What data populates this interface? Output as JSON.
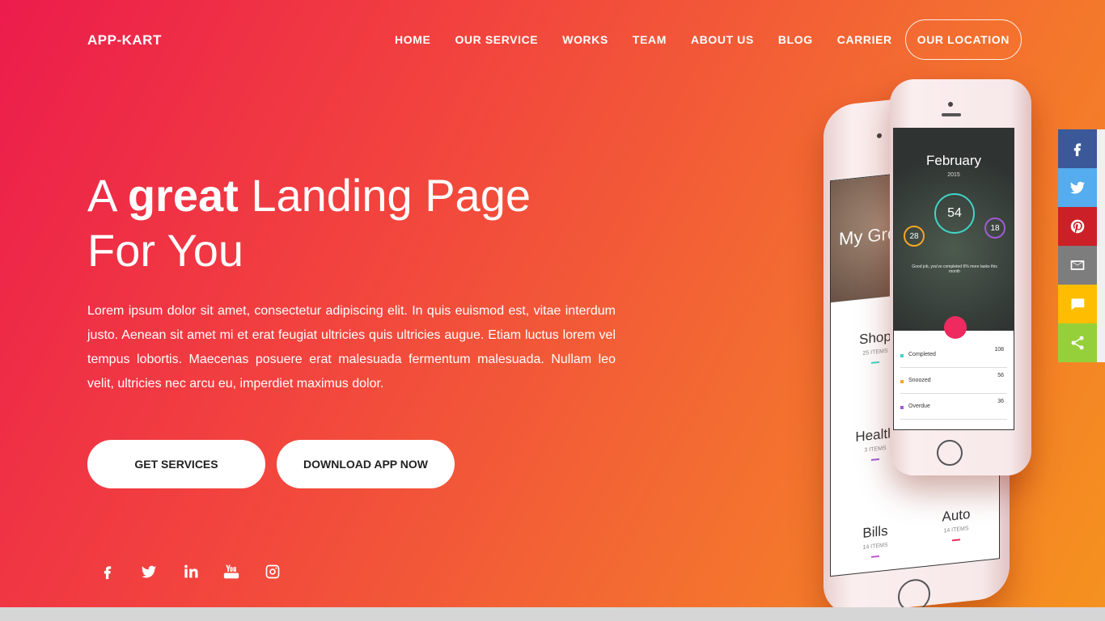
{
  "brand": {
    "logo": "APP-KART"
  },
  "nav": {
    "items": [
      {
        "label": "HOME"
      },
      {
        "label": "OUR SERVICE"
      },
      {
        "label": "WORKS"
      },
      {
        "label": "TEAM"
      },
      {
        "label": "ABOUT US"
      },
      {
        "label": "BLOG"
      },
      {
        "label": "CARRIER"
      }
    ],
    "cta": "OUR LOCATION"
  },
  "hero": {
    "title_prefix": "A ",
    "title_bold": "great",
    "title_rest": " Landing Page",
    "title_line2": "For You",
    "lead": "Lorem ipsum dolor sit amet, consectetur adipiscing elit. In quis euismod est, vitae interdum justo. Aenean sit amet mi et erat feugiat ultricies quis ultricies augue. Etiam luctus lorem vel tempus lobortis. Maecenas posuere erat malesuada fermentum malesuada. Nullam leo velit, ultricies nec arcu eu, imperdiet maximus dolor.",
    "buttons": {
      "services": "GET SERVICES",
      "download": "DOWNLOAD APP NOW"
    }
  },
  "socials": [
    "facebook-icon",
    "twitter-icon",
    "linkedin-icon",
    "youtube-icon",
    "instagram-icon"
  ],
  "share_bar": [
    {
      "icon": "facebook-icon",
      "color": "#3b5998"
    },
    {
      "icon": "twitter-icon",
      "color": "#55acee"
    },
    {
      "icon": "pinterest-icon",
      "color": "#cb2027"
    },
    {
      "icon": "email-icon",
      "color": "#7d7d7d"
    },
    {
      "icon": "sms-icon",
      "color": "#ffbd00"
    },
    {
      "icon": "share-icon",
      "color": "#95d03a"
    }
  ],
  "phone_front": {
    "month": "February",
    "year": "2015",
    "main_value": "54",
    "left_value": "28",
    "right_value": "18",
    "note": "Good job, you've completed 6% more tasks this month",
    "stats": [
      {
        "label": "Completed",
        "value": "108",
        "color": "#3fd6c8"
      },
      {
        "label": "Snoozed",
        "value": "56",
        "color": "#f5a623"
      },
      {
        "label": "Overdue",
        "value": "36",
        "color": "#a05bd8"
      }
    ]
  },
  "phone_back": {
    "title": "My Gro",
    "categories": [
      {
        "name": "Shop",
        "items": "25 ITEMS",
        "color": "#3fd6c8"
      },
      {
        "name": "Health",
        "items": "3 ITEMS",
        "color": "#a05bd8"
      },
      {
        "name": "Bills",
        "items": "14 ITEMS",
        "color": "#c255d0"
      },
      {
        "name": "Auto",
        "items": "14 ITEMS",
        "color": "#ee2a5e"
      }
    ]
  }
}
